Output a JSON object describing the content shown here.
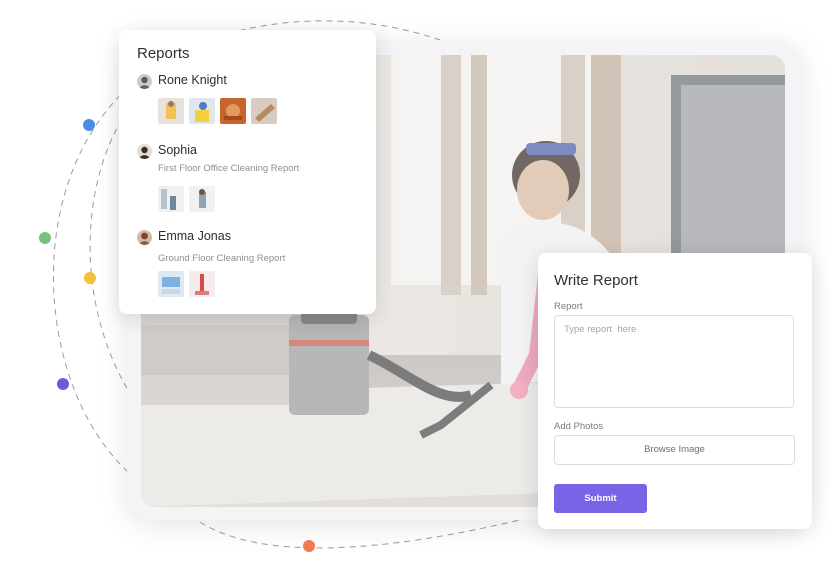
{
  "colors": {
    "accent": "#7a63e6",
    "orbit_dots": [
      "#4a8de6",
      "#78c07d",
      "#f3c23b",
      "#6a5ae0",
      "#f07b4f"
    ]
  },
  "reports_card": {
    "title": "Reports",
    "entries": [
      {
        "name": "Rone Knight",
        "subtitle": "",
        "photo_count": 4
      },
      {
        "name": "Sophia",
        "subtitle": "First Floor Office Cleaning Report",
        "photo_count": 2
      },
      {
        "name": "Emma Jonas",
        "subtitle": "Ground Floor Cleaning Report",
        "photo_count": 2
      }
    ]
  },
  "write_report": {
    "title": "Write Report",
    "report_label": "Report",
    "report_placeholder": "Type report  here",
    "photos_label": "Add Photos",
    "browse_label": "Browse Image",
    "submit_label": "Submit"
  }
}
